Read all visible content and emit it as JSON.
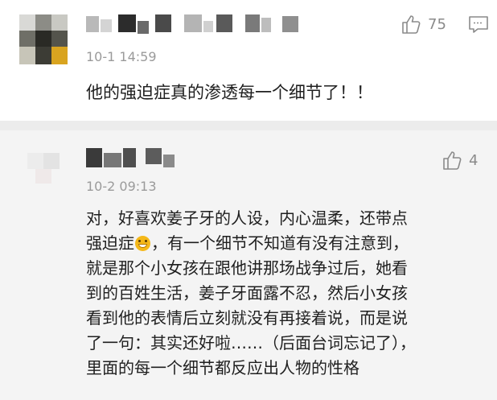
{
  "comments": [
    {
      "timestamp": "10-1 14:59",
      "likes": "75",
      "text": [
        "他的强迫症真的渗透每一个细节了！！"
      ]
    },
    {
      "timestamp": "10-2 09:13",
      "likes": "4",
      "text_before_emoji": "强迫症",
      "text_after_emoji": "，有一个细节不知道有没有注意到，",
      "lines": [
        "对，好喜欢姜子牙的人设，内心温柔，还带点",
        "就是那个小女孩在跟他讲那场战争过后，她看",
        "到的百姓生活，姜子牙面露不忍，然后小女孩",
        "看到他的表情后立刻就没有再接着说，而是说",
        "了一句：其实还好啦……（后面台词忘记了），",
        "里面的每一个细节都反应出人物的性格"
      ]
    }
  ],
  "icons": {
    "like": "thumbs-up-icon",
    "reply": "comment-icon",
    "emoji": "grin-emoji-icon"
  }
}
